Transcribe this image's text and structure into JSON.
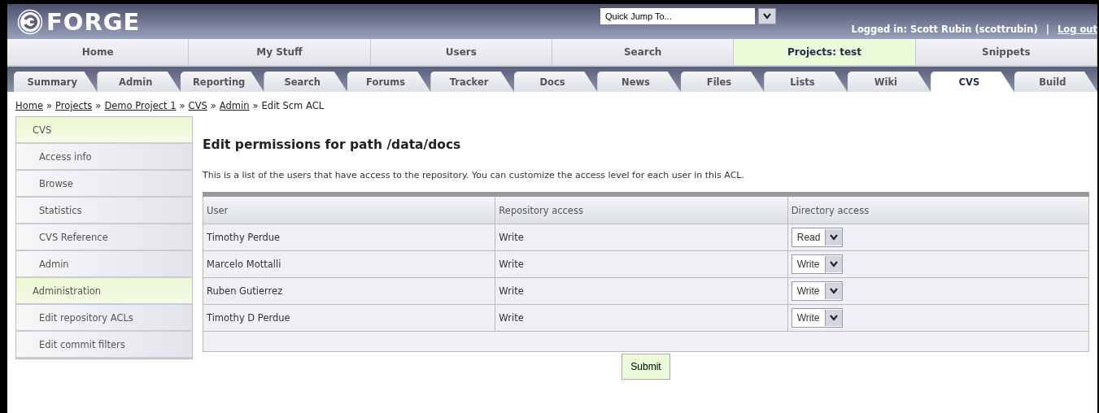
{
  "header": {
    "logo": "FORGE",
    "quick_jump": {
      "value": "Quick Jump To..."
    },
    "logged_in": "Logged in: Scott Rubin (scottrubin)",
    "divider": "|",
    "logout": "Log out"
  },
  "main_nav": [
    {
      "label": "Home",
      "selected": false
    },
    {
      "label": "My Stuff",
      "selected": false
    },
    {
      "label": "Users",
      "selected": false
    },
    {
      "label": "Search",
      "selected": false
    },
    {
      "label": "Projects: test",
      "selected": true
    },
    {
      "label": "Snippets",
      "selected": false
    }
  ],
  "project_tabs": [
    {
      "label": "Summary",
      "selected": false
    },
    {
      "label": "Admin",
      "selected": false
    },
    {
      "label": "Reporting",
      "selected": false
    },
    {
      "label": "Search",
      "selected": false
    },
    {
      "label": "Forums",
      "selected": false
    },
    {
      "label": "Tracker",
      "selected": false
    },
    {
      "label": "Docs",
      "selected": false
    },
    {
      "label": "News",
      "selected": false
    },
    {
      "label": "Files",
      "selected": false
    },
    {
      "label": "Lists",
      "selected": false
    },
    {
      "label": "Wiki",
      "selected": false
    },
    {
      "label": "CVS",
      "selected": true
    },
    {
      "label": "Build",
      "selected": false
    }
  ],
  "breadcrumb": [
    {
      "kind": "link",
      "text": "Home"
    },
    {
      "kind": "separator",
      "text": "»"
    },
    {
      "kind": "link",
      "text": "Projects"
    },
    {
      "kind": "separator",
      "text": "»"
    },
    {
      "kind": "link",
      "text": "Demo Project 1"
    },
    {
      "kind": "separator",
      "text": "»"
    },
    {
      "kind": "link",
      "text": "CVS"
    },
    {
      "kind": "separator",
      "text": "»"
    },
    {
      "kind": "link",
      "text": "Admin"
    },
    {
      "kind": "separator",
      "text": "»"
    },
    {
      "kind": "current",
      "text": "Edit Scm ACL"
    }
  ],
  "sidebar": {
    "items": [
      {
        "kind": "header",
        "label": "CVS"
      },
      {
        "kind": "item",
        "label": "Access info"
      },
      {
        "kind": "item",
        "label": "Browse"
      },
      {
        "kind": "item",
        "label": "Statistics"
      },
      {
        "kind": "item",
        "label": "CVS Reference"
      },
      {
        "kind": "item",
        "label": "Admin"
      },
      {
        "kind": "header",
        "label": "Administration"
      },
      {
        "kind": "item",
        "label": "Edit repository ACLs"
      },
      {
        "kind": "item",
        "label": "Edit commit filters"
      }
    ]
  },
  "content": {
    "title": "Edit permissions for path /data/docs",
    "description": "This is a list of the users that have access to the repository. You can customize the access level for each user in this ACL.",
    "table": {
      "columns": [
        "User",
        "Repository access",
        "Directory access"
      ],
      "rows": [
        {
          "user": "Timothy Perdue",
          "repository_access": "Write",
          "directory_access": "Read"
        },
        {
          "user": "Marcelo Mottalli",
          "repository_access": "Write",
          "directory_access": "Write"
        },
        {
          "user": "Ruben Gutierrez",
          "repository_access": "Write",
          "directory_access": "Write"
        },
        {
          "user": "Timothy D Perdue",
          "repository_access": "Write",
          "directory_access": "Write"
        }
      ]
    },
    "submit": "Submit"
  }
}
